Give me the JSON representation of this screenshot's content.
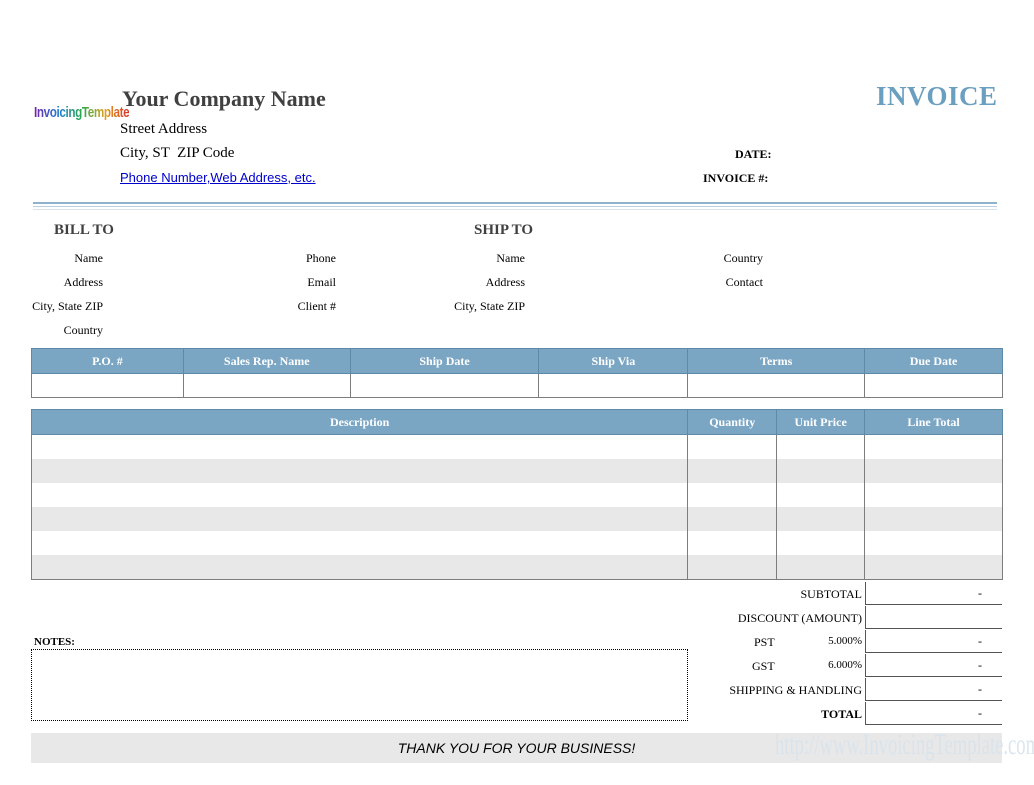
{
  "header": {
    "logo_text": "InvoicingTemplate",
    "company_name": "Your Company Name",
    "street": "Street Address",
    "city": "City, ST  ZIP Code",
    "phone": "Phone Number,Web Address, etc.",
    "title": "INVOICE",
    "date_label": "DATE:",
    "invoice_no_label": "INVOICE #:"
  },
  "bill_to": {
    "heading": "BILL TO",
    "name_label": "Name",
    "address_label": "Address",
    "city_label": "City, State ZIP",
    "country_label": "Country",
    "phone_label": "Phone",
    "email_label": "Email",
    "client_label": "Client #"
  },
  "ship_to": {
    "heading": "SHIP TO",
    "name_label": "Name",
    "address_label": "Address",
    "city_label": "City, State ZIP",
    "country_label": "Country",
    "contact_label": "Contact"
  },
  "order_info": {
    "columns": [
      "P.O. #",
      "Sales Rep. Name",
      "Ship Date",
      "Ship Via",
      "Terms",
      "Due Date"
    ]
  },
  "items": {
    "columns": [
      "Description",
      "Quantity",
      "Unit Price",
      "Line Total"
    ]
  },
  "totals": {
    "subtotal_label": "SUBTOTAL",
    "subtotal_value": "-",
    "discount_label": "DISCOUNT (AMOUNT)",
    "pst_label": "PST",
    "pst_rate": "5.000%",
    "pst_value": "-",
    "gst_label": "GST",
    "gst_rate": "6.000%",
    "gst_value": "-",
    "shipping_label": "SHIPPING & HANDLING",
    "shipping_value": "-",
    "total_label": "TOTAL",
    "total_value": "-"
  },
  "notes_label": "NOTES:",
  "thanks": "THANK YOU FOR YOUR BUSINESS!",
  "watermark": "http://www.InvoicingTemplate.com",
  "colors": {
    "accent": "#7aa6c4",
    "title": "#6b9fc0",
    "stripe": "#e8e8e8"
  }
}
